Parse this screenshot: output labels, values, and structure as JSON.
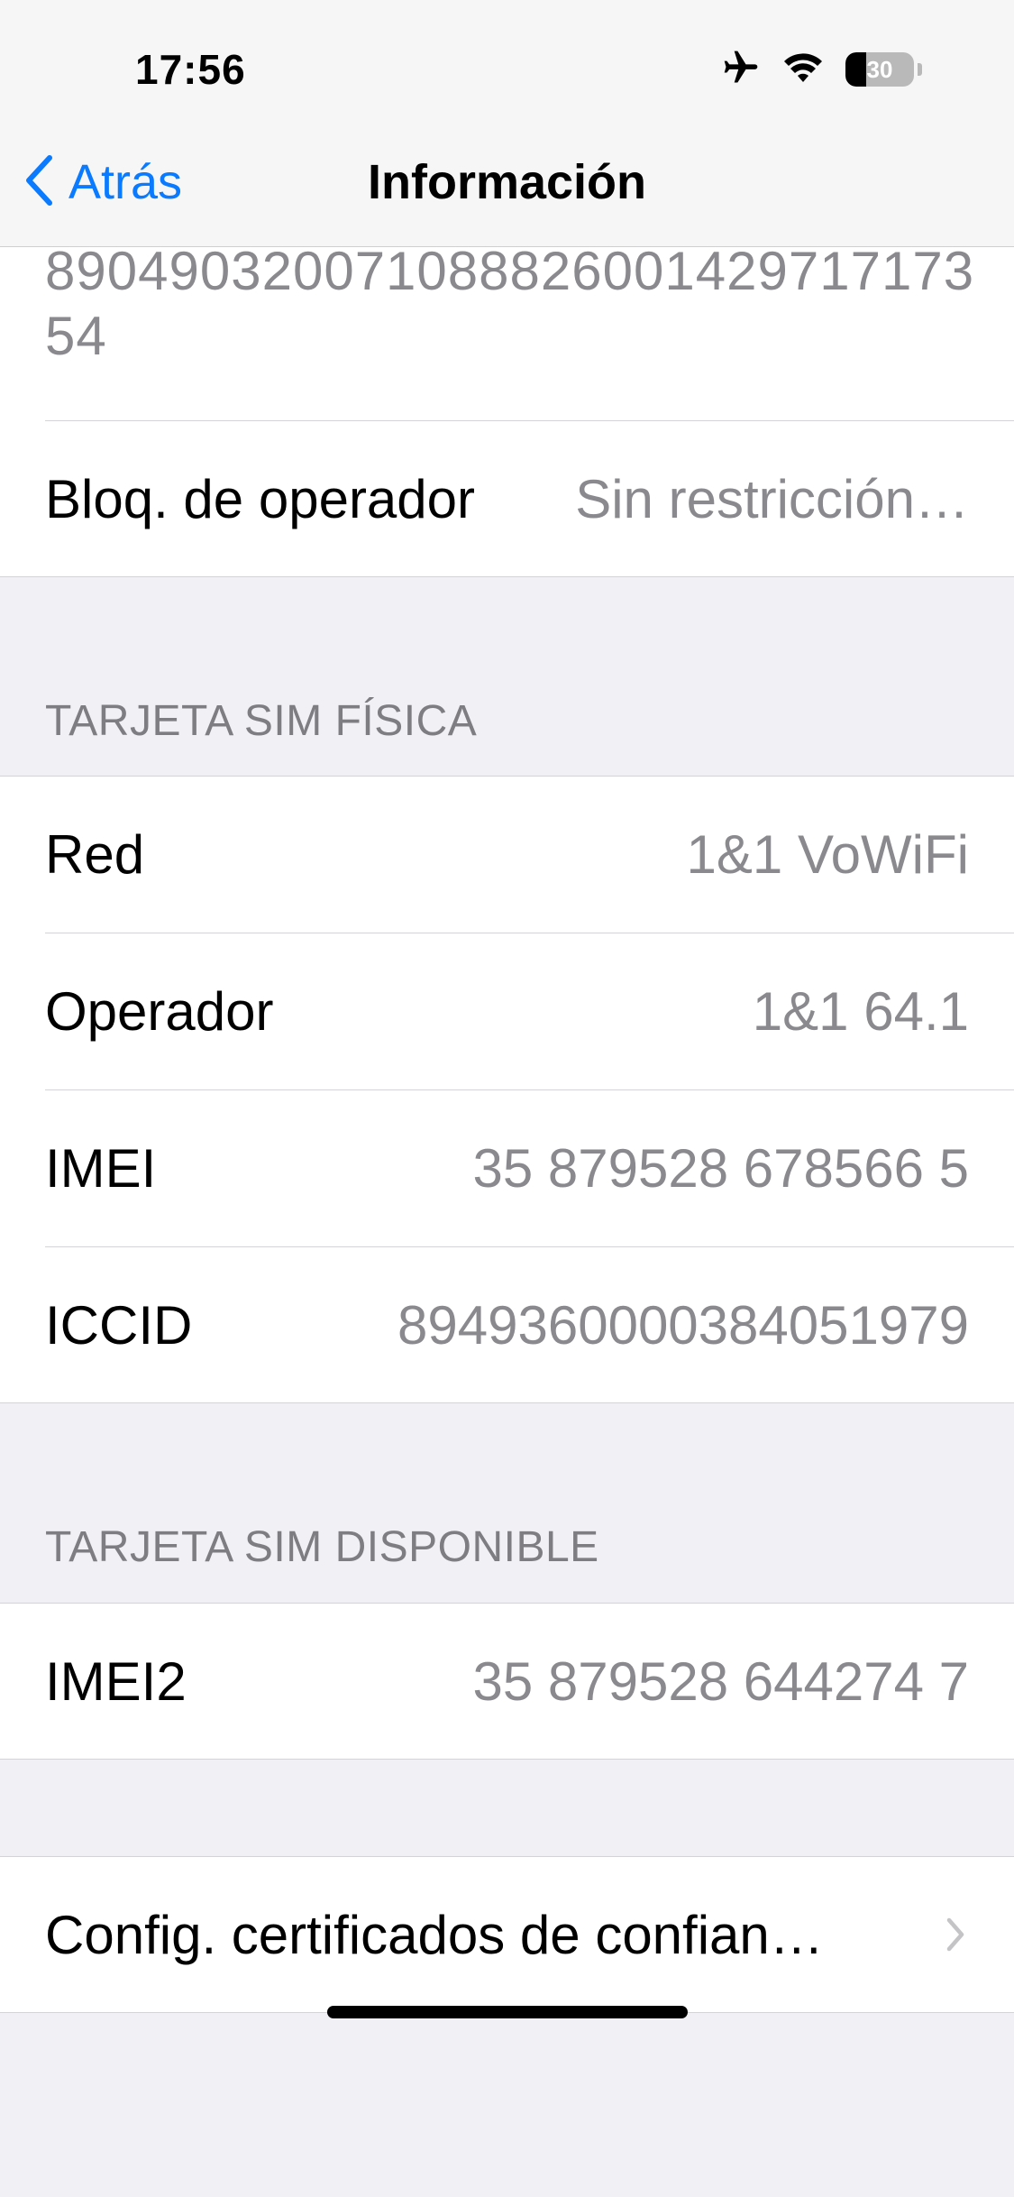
{
  "status_bar": {
    "time": "17:56",
    "battery_level": "30",
    "icons": [
      "airplane-icon",
      "wifi-icon",
      "battery-icon"
    ]
  },
  "nav": {
    "back_label": "Atrás",
    "title": "Información"
  },
  "top_section": {
    "partial_value": "8904903200710888260014297​1717354",
    "carrier_lock_label": "Bloq. de operador",
    "carrier_lock_value": "Sin restricción…"
  },
  "physical_sim": {
    "header": "TARJETA SIM FÍSICA",
    "rows": [
      {
        "label": "Red",
        "value": "1&1 VoWiFi"
      },
      {
        "label": "Operador",
        "value": "1&1 64.1"
      },
      {
        "label": "IMEI",
        "value": "35 879528 678566 5"
      },
      {
        "label": "ICCID",
        "value": "8949360000384051979"
      }
    ]
  },
  "available_sim": {
    "header": "TARJETA SIM DISPONIBLE",
    "rows": [
      {
        "label": "IMEI2",
        "value": "35 879528 644274 7"
      }
    ]
  },
  "certificates": {
    "label": "Config. certificados de confian…"
  },
  "colors": {
    "accent": "#0a7aff",
    "background": "#f0f0f5",
    "secondary_text": "#8a8a8e"
  }
}
